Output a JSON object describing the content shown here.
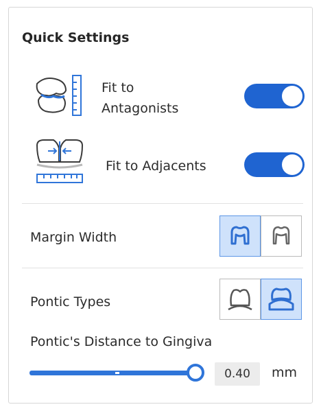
{
  "panel": {
    "title": "Quick Settings"
  },
  "fit_to_antagonists": {
    "label_line1": "Fit to",
    "label_line2": "Antagonists",
    "icon": "antagonist-fit-icon",
    "enabled": true
  },
  "fit_to_adjacents": {
    "label": "Fit to Adjacents",
    "icon": "adjacent-fit-icon",
    "enabled": true
  },
  "margin_width": {
    "label": "Margin Width",
    "options": [
      {
        "icon": "wide-margin-tooth-icon",
        "selected": true
      },
      {
        "icon": "narrow-margin-tooth-icon",
        "selected": false
      }
    ]
  },
  "pontic_types": {
    "label": "Pontic Types",
    "options": [
      {
        "icon": "pontic-type-1-icon",
        "selected": false
      },
      {
        "icon": "pontic-type-2-icon",
        "selected": true
      }
    ]
  },
  "pontic_distance": {
    "label": "Pontic's Distance to Gingiva",
    "value": "0.40",
    "unit": "mm"
  },
  "colors": {
    "accent": "#1f64d1",
    "selected_bg": "#cfe2fb"
  }
}
